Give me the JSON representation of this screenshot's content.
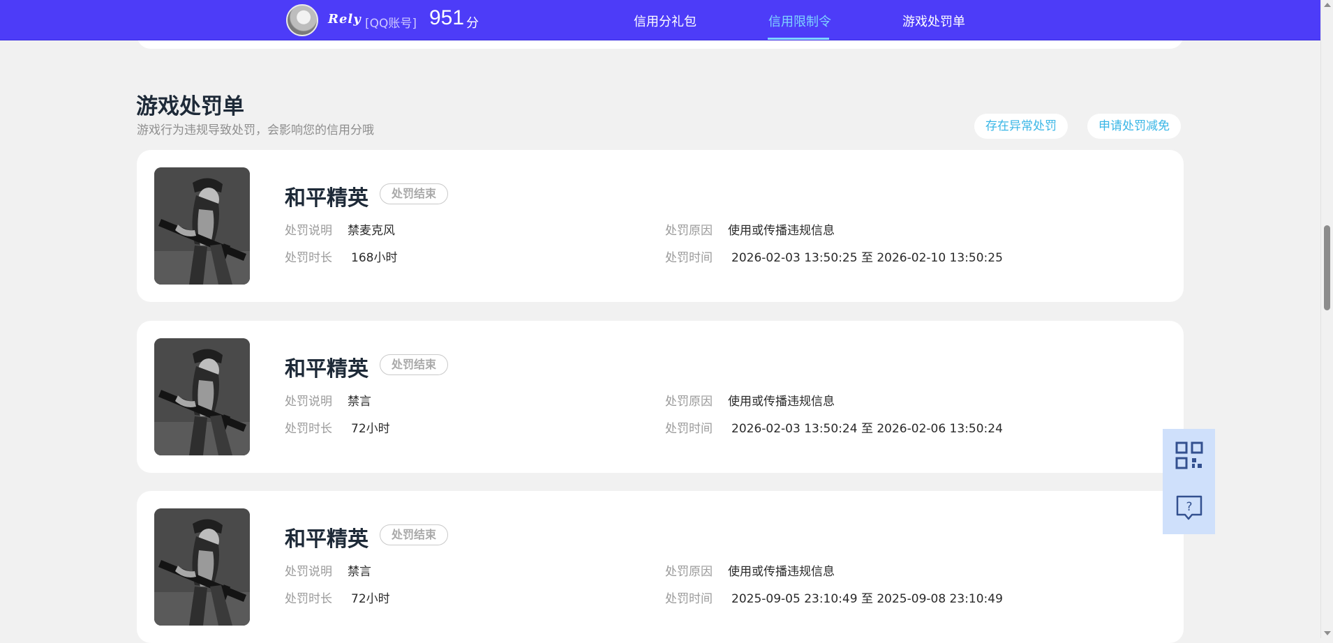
{
  "header": {
    "nickname": "Rely",
    "account_label": "[QQ账号]",
    "score": "951",
    "score_unit": "分",
    "tabs": [
      {
        "label": "信用分礼包",
        "active": false
      },
      {
        "label": "信用限制令",
        "active": true
      },
      {
        "label": "游戏处罚单",
        "active": false
      }
    ]
  },
  "section": {
    "title": "游戏处罚单",
    "subtitle": "游戏行为违规导致处罚，会影响您的信用分哦",
    "actions": [
      "存在异常处罚",
      "申请处罚减免"
    ]
  },
  "labels": {
    "desc": "处罚说明",
    "duration": "处罚时长",
    "reason": "处罚原因",
    "time": "处罚时间"
  },
  "penalties": [
    {
      "game": "和平精英",
      "status": "处罚结束",
      "desc": "禁麦克风",
      "duration": "168小时",
      "reason": "使用或传播违规信息",
      "time": "2026-02-03 13:50:25 至 2026-02-10 13:50:25"
    },
    {
      "game": "和平精英",
      "status": "处罚结束",
      "desc": "禁言",
      "duration": "72小时",
      "reason": "使用或传播违规信息",
      "time": "2026-02-03 13:50:24 至 2026-02-06 13:50:24"
    },
    {
      "game": "和平精英",
      "status": "处罚结束",
      "desc": "禁言",
      "duration": "72小时",
      "reason": "使用或传播违规信息",
      "time": "2025-09-05 23:10:49 至 2025-09-08 23:10:49"
    }
  ],
  "side_tools": {
    "qr_icon": "qr-code-icon",
    "help_icon": "help-chat-icon"
  },
  "colors": {
    "nav_bg": "#4d3cf8",
    "nav_active": "#7fd4ff",
    "accent_link": "#39b6e6",
    "page_bg": "#f1f1f1",
    "float_btn": "#cfe0fb"
  }
}
